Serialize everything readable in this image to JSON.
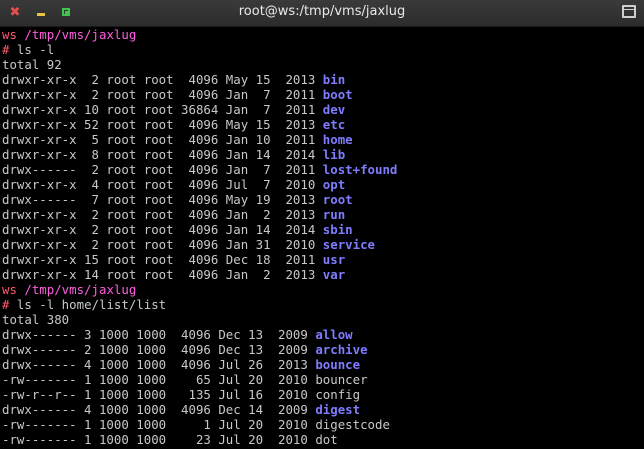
{
  "window": {
    "title": "root@ws:/tmp/vms/jaxlug",
    "close_glyph": "✖",
    "colors": {
      "background": "#000000",
      "text": "#c8c8c8",
      "prompt_host": "#ff5b6e",
      "prompt_path": "#ff5ee0",
      "directory": "#7f7cff"
    }
  },
  "terminal": {
    "lines": [
      {
        "type": "prompt",
        "host": "ws",
        "path": " /tmp/vms/jaxlug"
      },
      {
        "type": "command",
        "hash": "#",
        "cmd": " ls -l"
      },
      {
        "type": "text",
        "text": "total 92"
      },
      {
        "type": "entry",
        "meta": "drwxr-xr-x  2 root root  4096 May 15  2013 ",
        "name": "bin",
        "is_dir": true
      },
      {
        "type": "entry",
        "meta": "drwxr-xr-x  2 root root  4096 Jan  7  2011 ",
        "name": "boot",
        "is_dir": true
      },
      {
        "type": "entry",
        "meta": "drwxr-xr-x 10 root root 36864 Jan  7  2011 ",
        "name": "dev",
        "is_dir": true
      },
      {
        "type": "entry",
        "meta": "drwxr-xr-x 52 root root  4096 May 15  2013 ",
        "name": "etc",
        "is_dir": true
      },
      {
        "type": "entry",
        "meta": "drwxr-xr-x  5 root root  4096 Jan 10  2011 ",
        "name": "home",
        "is_dir": true
      },
      {
        "type": "entry",
        "meta": "drwxr-xr-x  8 root root  4096 Jan 14  2014 ",
        "name": "lib",
        "is_dir": true
      },
      {
        "type": "entry",
        "meta": "drwx------  2 root root  4096 Jan  7  2011 ",
        "name": "lost+found",
        "is_dir": true
      },
      {
        "type": "entry",
        "meta": "drwxr-xr-x  4 root root  4096 Jul  7  2010 ",
        "name": "opt",
        "is_dir": true
      },
      {
        "type": "entry",
        "meta": "drwx------  7 root root  4096 May 19  2013 ",
        "name": "root",
        "is_dir": true
      },
      {
        "type": "entry",
        "meta": "drwxr-xr-x  2 root root  4096 Jan  2  2013 ",
        "name": "run",
        "is_dir": true
      },
      {
        "type": "entry",
        "meta": "drwxr-xr-x  2 root root  4096 Jan 14  2014 ",
        "name": "sbin",
        "is_dir": true
      },
      {
        "type": "entry",
        "meta": "drwxr-xr-x  2 root root  4096 Jan 31  2010 ",
        "name": "service",
        "is_dir": true
      },
      {
        "type": "entry",
        "meta": "drwxr-xr-x 15 root root  4096 Dec 18  2011 ",
        "name": "usr",
        "is_dir": true
      },
      {
        "type": "entry",
        "meta": "drwxr-xr-x 14 root root  4096 Jan  2  2013 ",
        "name": "var",
        "is_dir": true
      },
      {
        "type": "prompt",
        "host": "ws",
        "path": " /tmp/vms/jaxlug"
      },
      {
        "type": "command",
        "hash": "#",
        "cmd": " ls -l home/list/list"
      },
      {
        "type": "text",
        "text": "total 380"
      },
      {
        "type": "entry",
        "meta": "drwx------ 3 1000 1000  4096 Dec 13  2009 ",
        "name": "allow",
        "is_dir": true
      },
      {
        "type": "entry",
        "meta": "drwx------ 2 1000 1000  4096 Dec 13  2009 ",
        "name": "archive",
        "is_dir": true
      },
      {
        "type": "entry",
        "meta": "drwx------ 4 1000 1000  4096 Jul 26  2013 ",
        "name": "bounce",
        "is_dir": true
      },
      {
        "type": "entry",
        "meta": "-rw------- 1 1000 1000    65 Jul 20  2010 ",
        "name": "bouncer",
        "is_dir": false
      },
      {
        "type": "entry",
        "meta": "-rw-r--r-- 1 1000 1000   135 Jul 16  2010 ",
        "name": "config",
        "is_dir": false
      },
      {
        "type": "entry",
        "meta": "drwx------ 4 1000 1000  4096 Dec 14  2009 ",
        "name": "digest",
        "is_dir": true
      },
      {
        "type": "entry",
        "meta": "-rw------- 1 1000 1000     1 Jul 20  2010 ",
        "name": "digestcode",
        "is_dir": false
      },
      {
        "type": "entry",
        "meta": "-rw------- 1 1000 1000    23 Jul 20  2010 ",
        "name": "dot",
        "is_dir": false
      }
    ]
  }
}
